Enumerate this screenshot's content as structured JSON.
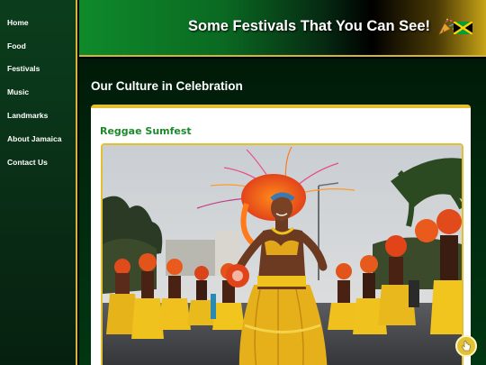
{
  "nav": {
    "items": [
      {
        "label": "Home"
      },
      {
        "label": "Food"
      },
      {
        "label": "Festivals"
      },
      {
        "label": "Music"
      },
      {
        "label": "Landmarks"
      },
      {
        "label": "About Jamaica"
      },
      {
        "label": "Contact Us"
      }
    ]
  },
  "header": {
    "title": "Some Festivals That You Can See!",
    "icons": [
      "party-popper-icon",
      "jamaica-flag-icon"
    ]
  },
  "main": {
    "section_title": "Our Culture in Celebration",
    "card": {
      "title": "Reggae Sumfest",
      "image": "carnival-dancer-photo"
    }
  },
  "colors": {
    "accent_gold": "#d4b43a",
    "brand_green": "#1c8a2a",
    "sidebar_bg": "#0b3d1c"
  },
  "floating_button": {
    "icon": "cursor-hand-icon"
  }
}
